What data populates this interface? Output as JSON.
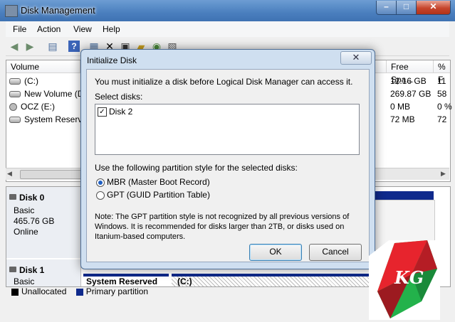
{
  "window": {
    "title": "Disk Management",
    "min_glyph": "–",
    "max_glyph": "□",
    "close_glyph": "✕"
  },
  "menu": [
    "File",
    "Action",
    "View",
    "Help"
  ],
  "toolbar_icons": [
    "back-arrow-icon",
    "forward-arrow-icon",
    "console-tree-icon",
    "help-icon",
    "refresh-icon",
    "delete-icon",
    "properties-icon",
    "open-folder-icon",
    "rescan-icon",
    "export-icon"
  ],
  "volume_list": {
    "columns": [
      "Volume",
      "Free Spa...",
      "% F"
    ],
    "rows": [
      {
        "name": "(C:)",
        "free": "12.16 GB",
        "pct": "11"
      },
      {
        "name": "New Volume (D",
        "free": "269.87 GB",
        "pct": "58"
      },
      {
        "name": "OCZ (E:)",
        "free": "0 MB",
        "pct": "0 %"
      },
      {
        "name": "System Reserved",
        "free": "72 MB",
        "pct": "72"
      }
    ]
  },
  "disks": [
    {
      "name": "Disk 0",
      "type": "Basic",
      "size": "465.76 GB",
      "status": "Online"
    },
    {
      "name": "Disk 1",
      "type": "Basic",
      "partitions": [
        "System Reserved",
        "(C:)"
      ]
    }
  ],
  "legend": [
    "Unallocated",
    "Primary partition"
  ],
  "colors": {
    "titlebar": "#4a7fbe",
    "primary_partition": "#0f2a8c",
    "unallocated": "#000000"
  },
  "dialog": {
    "title": "Initialize Disk",
    "message": "You must initialize a disk before Logical Disk Manager can access it.",
    "select_label": "Select disks:",
    "disks": [
      {
        "label": "Disk 2",
        "checked": true
      }
    ],
    "partition_label": "Use the following partition style for the selected disks:",
    "options": [
      {
        "label": "MBR (Master Boot Record)",
        "selected": true
      },
      {
        "label": "GPT (GUID Partition Table)",
        "selected": false
      }
    ],
    "note_lines": [
      "Note: The GPT partition style is not recognized by all previous versions of",
      "Windows. It is recommended for disks larger than 2TB, or disks used on",
      "Itanium-based computers."
    ],
    "ok_label": "OK",
    "cancel_label": "Cancel"
  },
  "watermark": "KG"
}
